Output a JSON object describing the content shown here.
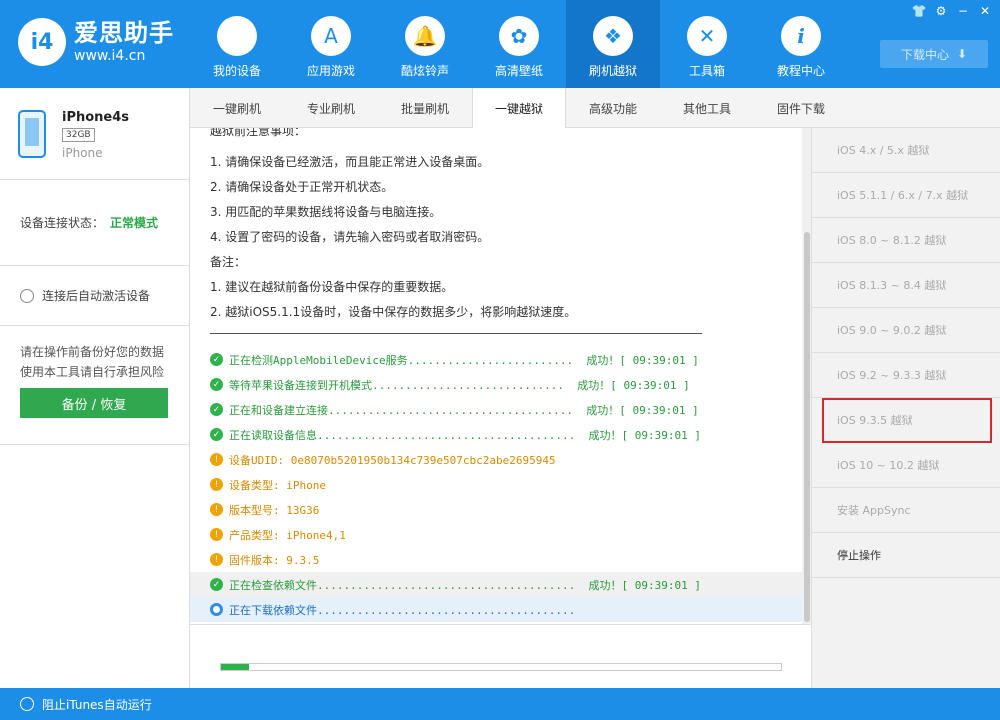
{
  "app": {
    "logo_mark": "i4",
    "title": "爱思助手",
    "url": "www.i4.cn"
  },
  "nav": [
    {
      "label": "我的设备",
      "icon": "apple-icon",
      "glyph": ""
    },
    {
      "label": "应用游戏",
      "icon": "app-store-icon",
      "glyph": "A"
    },
    {
      "label": "酷炫铃声",
      "icon": "bell-icon",
      "glyph": "🔔"
    },
    {
      "label": "高清壁纸",
      "icon": "flower-icon",
      "glyph": "✿"
    },
    {
      "label": "刷机越狱",
      "icon": "dropbox-icon",
      "glyph": "❖"
    },
    {
      "label": "工具箱",
      "icon": "tools-icon",
      "glyph": "✕"
    },
    {
      "label": "教程中心",
      "icon": "info-icon",
      "glyph": "i"
    }
  ],
  "window_controls": [
    "👕",
    "⚙",
    "−",
    "✕"
  ],
  "download_center": {
    "label": "下载中心",
    "icon": "download-icon",
    "glyph": "⬇"
  },
  "device": {
    "name": "iPhone4s",
    "capacity": "32GB",
    "type": "iPhone"
  },
  "status": {
    "label": "设备连接状态：",
    "value": "正常模式"
  },
  "auto_activate": "连接后自动激活设备",
  "warning": {
    "line1": "请在操作前备份好您的数据",
    "line2": "使用本工具请自行承担风险"
  },
  "backup_button": "备份 / 恢复",
  "bottom": "阻止iTunes自动运行",
  "tabs": [
    "一键刷机",
    "专业刷机",
    "批量刷机",
    "一键越狱",
    "高级功能",
    "其他工具",
    "固件下载"
  ],
  "instructions": {
    "partial_top": "越狱前注意事项：",
    "items": [
      "1. 请确保设备已经激活，而且能正常进入设备桌面。",
      "2. 请确保设备处于正常开机状态。",
      "3. 用匹配的苹果数据线将设备与电脑连接。",
      "4. 设置了密码的设备，请先输入密码或者取消密码。"
    ],
    "notes_title": "备注：",
    "notes": [
      "1. 建议在越狱前备份设备中保存的重要数据。",
      "2. 越狱iOS5.1.1设备时，设备中保存的数据多少，将影响越狱速度。"
    ]
  },
  "log": [
    {
      "kind": "ok",
      "text": "正在检测AppleMobileDevice服务.........................  成功！[ 09:39:01 ]"
    },
    {
      "kind": "ok",
      "text": "等待苹果设备连接到开机模式.............................  成功！[ 09:39:01 ]"
    },
    {
      "kind": "ok",
      "text": "正在和设备建立连接.....................................  成功！[ 09:39:01 ]"
    },
    {
      "kind": "ok",
      "text": "正在读取设备信息.......................................  成功！[ 09:39:01 ]"
    },
    {
      "kind": "info",
      "text": "设备UDID: 0e8070b5201950b134c739e507cbc2abe2695945"
    },
    {
      "kind": "info",
      "text": "设备类型: iPhone"
    },
    {
      "kind": "info",
      "text": "版本型号: 13G36"
    },
    {
      "kind": "info",
      "text": "产品类型: iPhone4,1"
    },
    {
      "kind": "info",
      "text": "固件版本: 9.3.5"
    },
    {
      "kind": "ok",
      "text": "正在检查依赖文件.......................................  成功！[ 09:39:01 ]"
    },
    {
      "kind": "load",
      "text": "正在下载依赖文件......................................."
    }
  ],
  "progress_fraction": 0.05,
  "jailbreak_options": [
    "iOS 4.x / 5.x 越狱",
    "iOS 5.1.1 / 6.x / 7.x 越狱",
    "iOS 8.0 ~ 8.1.2 越狱",
    "iOS 8.1.3 ~ 8.4 越狱",
    "iOS 9.0 ~ 9.0.2 越狱",
    "iOS 9.2 ~ 9.3.3 越狱",
    "iOS 9.3.5 越狱",
    "iOS 10 ~ 10.2 越狱",
    "安装 AppSync",
    "停止操作"
  ]
}
